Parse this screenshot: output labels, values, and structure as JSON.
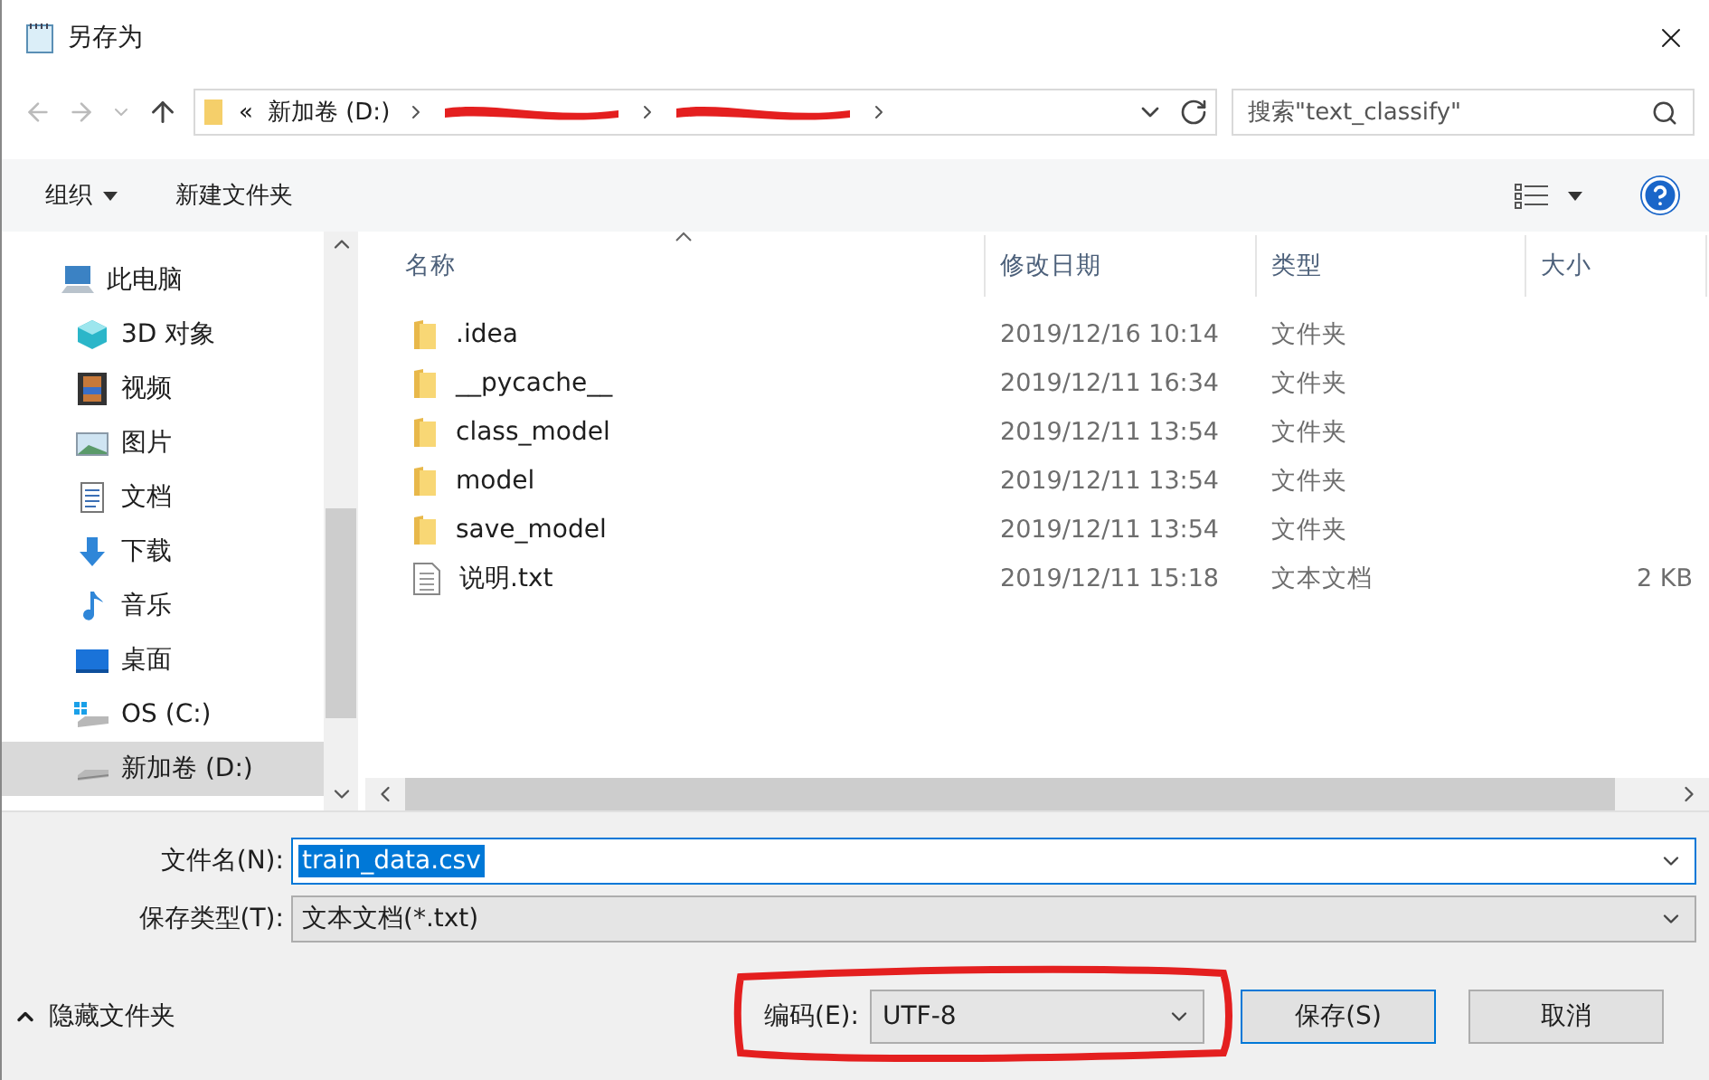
{
  "window": {
    "title": "另存为"
  },
  "address": {
    "prefix": "«",
    "segments": [
      {
        "kind": "text",
        "label": "新加卷 (D:)"
      },
      {
        "kind": "redacted"
      },
      {
        "kind": "redacted"
      }
    ]
  },
  "search": {
    "placeholder": "搜索\"text_classify\""
  },
  "toolbar": {
    "organize": "组织",
    "new_folder": "新建文件夹"
  },
  "sidebar": {
    "items": [
      {
        "label": "此电脑",
        "kind": "computer",
        "selected": false,
        "children": [
          {
            "label": "3D 对象",
            "kind": "cube",
            "selected": false
          },
          {
            "label": "视频",
            "kind": "film",
            "selected": false
          },
          {
            "label": "图片",
            "kind": "image",
            "selected": false
          },
          {
            "label": "文档",
            "kind": "doc",
            "selected": false
          },
          {
            "label": "下载",
            "kind": "download",
            "selected": false
          },
          {
            "label": "音乐",
            "kind": "music",
            "selected": false
          },
          {
            "label": "桌面",
            "kind": "desktop",
            "selected": false
          },
          {
            "label": "OS (C:)",
            "kind": "osdrive",
            "selected": false
          },
          {
            "label": "新加卷 (D:)",
            "kind": "drive",
            "selected": true
          }
        ]
      }
    ]
  },
  "table": {
    "columns": [
      {
        "label": "名称",
        "sorted": true
      },
      {
        "label": "修改日期",
        "sorted": false
      },
      {
        "label": "类型",
        "sorted": false
      },
      {
        "label": "大小",
        "sorted": false
      }
    ],
    "rows": [
      {
        "kind": "folder",
        "name": ".idea",
        "date": "2019/12/16 10:14",
        "type": "文件夹"
      },
      {
        "kind": "folder",
        "name": "__pycache__",
        "date": "2019/12/11 16:34",
        "type": "文件夹"
      },
      {
        "kind": "folder",
        "name": "class_model",
        "date": "2019/12/11 13:54",
        "type": "文件夹"
      },
      {
        "kind": "folder",
        "name": "model",
        "date": "2019/12/11 13:54",
        "type": "文件夹"
      },
      {
        "kind": "folder",
        "name": "save_model",
        "date": "2019/12/11 13:54",
        "type": "文件夹"
      },
      {
        "kind": "file",
        "name": "说明.txt",
        "date": "2019/12/11 15:18",
        "type": "文本文档",
        "size": "2 KB"
      }
    ]
  },
  "form": {
    "file_name_label": "文件名(N):",
    "file_name": "train_data.csv",
    "file_name_selected": true,
    "file_type_label": "保存类型(T):",
    "file_type": "文本文档(*.txt)"
  },
  "footer": {
    "hide_folders": "隐藏文件夹",
    "encoding_label": "编码(E):",
    "encoding": "UTF-8",
    "encoding_circled": true,
    "save": "保存(S)",
    "cancel": "取消"
  }
}
